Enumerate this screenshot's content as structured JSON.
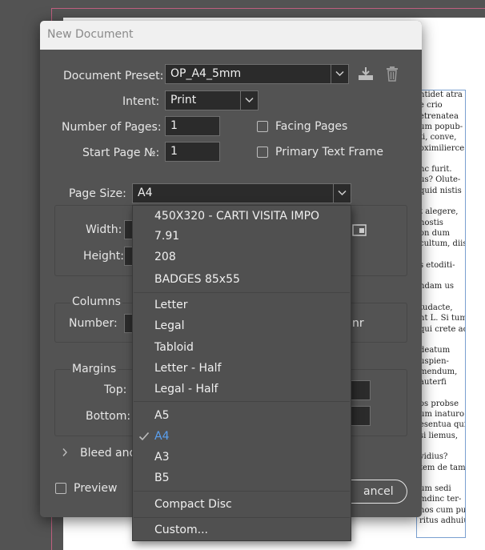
{
  "background_text": [
    "ntidet atra",
    "e crio",
    "etrenatea",
    "um popub-",
    "ti, conve,",
    "oximilierce",
    "",
    "nc furit.",
    "us? Olute-",
    "quid nistis",
    "",
    "t alegere,",
    "nostis",
    "on dum",
    "cultum, diis",
    "",
    "s etoditi-",
    "",
    "ndam us",
    "",
    "tudacte,",
    "nt L. Si tum",
    "qui crete ac",
    "",
    "deatum",
    "uspien-",
    "mendum,",
    "auterfi",
    "",
    "os probse",
    "um inaturo",
    "esentua quid",
    "si liemus,",
    "",
    "vidius?",
    "tem de tam",
    "",
    "um sedi",
    "mdinc ter-",
    "nos cum publicla vid sterfer",
    "ritus adhuiusat, perum"
  ],
  "dialog": {
    "title": "New Document",
    "preset_label": "Document Preset:",
    "preset_value": "OP_A4_5mm",
    "intent_label": "Intent:",
    "intent_value": "Print",
    "pages_label": "Number of Pages:",
    "pages_value": "1",
    "start_label": "Start Page №:",
    "start_value": "1",
    "facing_label": "Facing Pages",
    "primary_label": "Primary Text Frame",
    "page_size_label": "Page Size:",
    "page_size_value": "A4",
    "width_label": "Width:",
    "height_label": "Height:",
    "columns_title": "Columns",
    "number_label": "Number:",
    "gutter_fragment": "nr",
    "margins_title": "Margins",
    "top_label": "Top:",
    "bottom_label": "Bottom:",
    "bleed_label": "Bleed and",
    "preview_label": "Preview",
    "cancel_label": "ancel"
  },
  "menu": {
    "items": [
      {
        "label": "450X320 - CARTI VISITA IMPO"
      },
      {
        "label": "7.91"
      },
      {
        "label": "208"
      },
      {
        "label": "BADGES 85x55"
      },
      {
        "label": "Letter"
      },
      {
        "label": "Legal"
      },
      {
        "label": "Tabloid"
      },
      {
        "label": "Letter - Half"
      },
      {
        "label": "Legal - Half"
      },
      {
        "label": "A5"
      },
      {
        "label": "A4"
      },
      {
        "label": "A3"
      },
      {
        "label": "B5"
      },
      {
        "label": "Compact Disc"
      },
      {
        "label": "Custom..."
      }
    ],
    "selected": "A4",
    "selected_color": "#5aa0f0"
  },
  "icons": [
    "save-preset-icon",
    "delete-preset-icon",
    "chevron-down-icon",
    "checkmark-icon",
    "chevron-right-icon",
    "orientation-icon"
  ]
}
